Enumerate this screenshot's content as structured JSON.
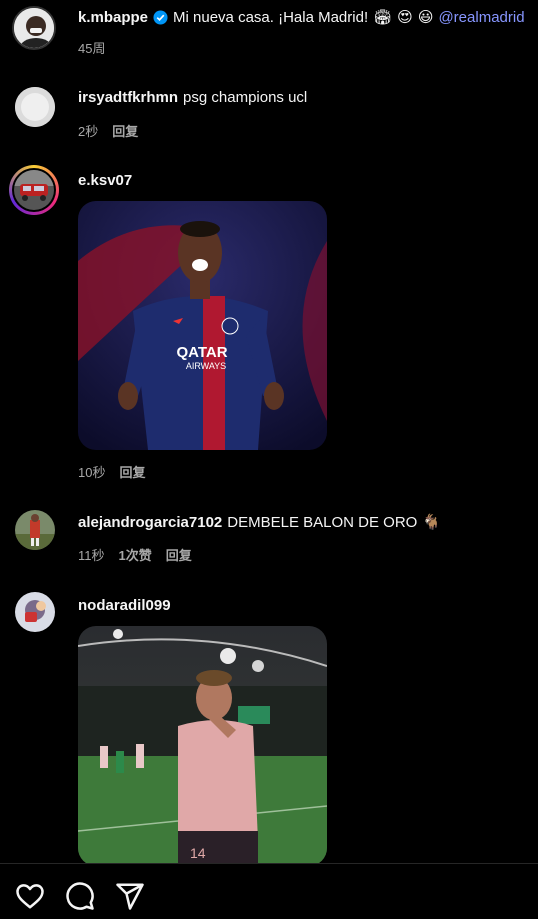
{
  "post": {
    "username": "k.mbappe",
    "caption": "Mi nueva casa. ¡Hala Madrid!",
    "emojis": [
      "🏟",
      "😍",
      "😃"
    ],
    "mention": "@realmadrid",
    "time": "45周"
  },
  "comments": [
    {
      "username": "irsyadtfkrhmn",
      "text": "psg champions ucl",
      "time": "2秒",
      "reply_label": "回复"
    },
    {
      "username": "e.ksv07",
      "text": "",
      "time": "10秒",
      "reply_label": "回复"
    },
    {
      "username": "alejandrogarcia7102",
      "text": "DEMBELE BALON DE ORO",
      "emoji": "🐐",
      "time": "11秒",
      "likes_label": "1次赞",
      "reply_label": "回复"
    },
    {
      "username": "nodaradil099",
      "text": "",
      "time": "",
      "reply_label": ""
    }
  ],
  "gif1": {
    "sponsor_top": "QATAR",
    "sponsor_bottom": "AIRWAYS"
  },
  "gif2": {
    "number": "14"
  },
  "bottom_bar": {
    "icons": [
      "heart-icon",
      "comment-icon",
      "share-icon"
    ]
  },
  "colors": {
    "mention": "#8796ff",
    "meta": "#a8a8a8",
    "verified": "#0095f6"
  }
}
